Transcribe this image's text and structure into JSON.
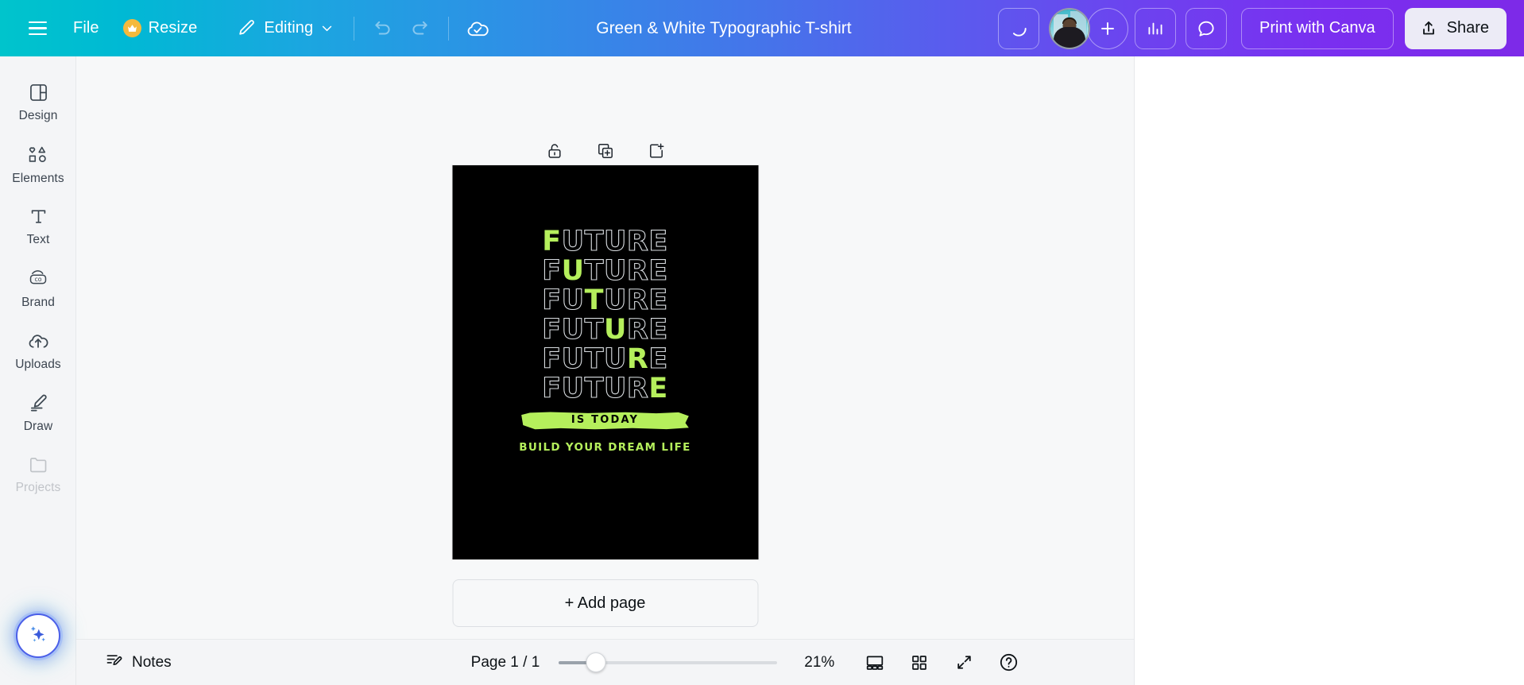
{
  "header": {
    "menu_icon": "hamburger-icon",
    "file_label": "File",
    "resize_label": "Resize",
    "resize_badge_icon": "crown-icon",
    "editing_label": "Editing",
    "editing_chevron_icon": "chevron-down-icon",
    "undo_icon": "undo-icon",
    "redo_icon": "redo-icon",
    "cloud_saved_icon": "cloud-check-icon",
    "doc_title": "Green & White Typographic T-shirt",
    "spinner_icon": "loading-spinner-icon",
    "avatar_icon": "user-avatar",
    "invite_icon": "plus-icon",
    "analytics_icon": "bar-chart-icon",
    "comment_icon": "comment-bubble-icon",
    "print_label": "Print with Canva",
    "share_label": "Share",
    "share_icon": "share-upload-icon",
    "gradient_start": "#00c4cc",
    "gradient_mid": "#4574ea",
    "gradient_end": "#7d2ae8"
  },
  "sidebar": {
    "items": [
      {
        "label": "Design",
        "icon": "design-panel-icon"
      },
      {
        "label": "Elements",
        "icon": "shapes-icon"
      },
      {
        "label": "Text",
        "icon": "text-t-icon"
      },
      {
        "label": "Brand",
        "icon": "brand-co-icon"
      },
      {
        "label": "Uploads",
        "icon": "cloud-upload-icon"
      },
      {
        "label": "Draw",
        "icon": "pen-draw-icon"
      },
      {
        "label": "Projects",
        "icon": "folder-icon"
      }
    ],
    "magic_button_icon": "magic-sparkle-icon",
    "magic_accent": "#4b5fe8"
  },
  "page_tools": {
    "lock_icon": "unlock-icon",
    "duplicate_icon": "duplicate-page-icon",
    "add_page_icon": "add-page-icon"
  },
  "design": {
    "background": "#000000",
    "accent_green": "#b5ef5c",
    "outline_color": "#d8dce0",
    "word": "FUTURE",
    "rows": [
      {
        "highlight_index": 0
      },
      {
        "highlight_index": 1
      },
      {
        "highlight_index": 2
      },
      {
        "highlight_index": 3
      },
      {
        "highlight_index": 4
      },
      {
        "highlight_index": 5
      }
    ],
    "brush_text": "IS TODAY",
    "tagline": "BUILD YOUR DREAM LIFE"
  },
  "canvas": {
    "add_page_label": "+ Add page"
  },
  "bottom": {
    "notes_label": "Notes",
    "notes_icon": "notes-pencil-icon",
    "page_indicator": "Page 1 / 1",
    "zoom_percent": "21%",
    "slider_value": 17,
    "presentation_icon": "presentation-view-icon",
    "grid_icon": "grid-view-icon",
    "fullscreen_icon": "fullscreen-expand-icon",
    "help_icon": "help-question-icon"
  }
}
